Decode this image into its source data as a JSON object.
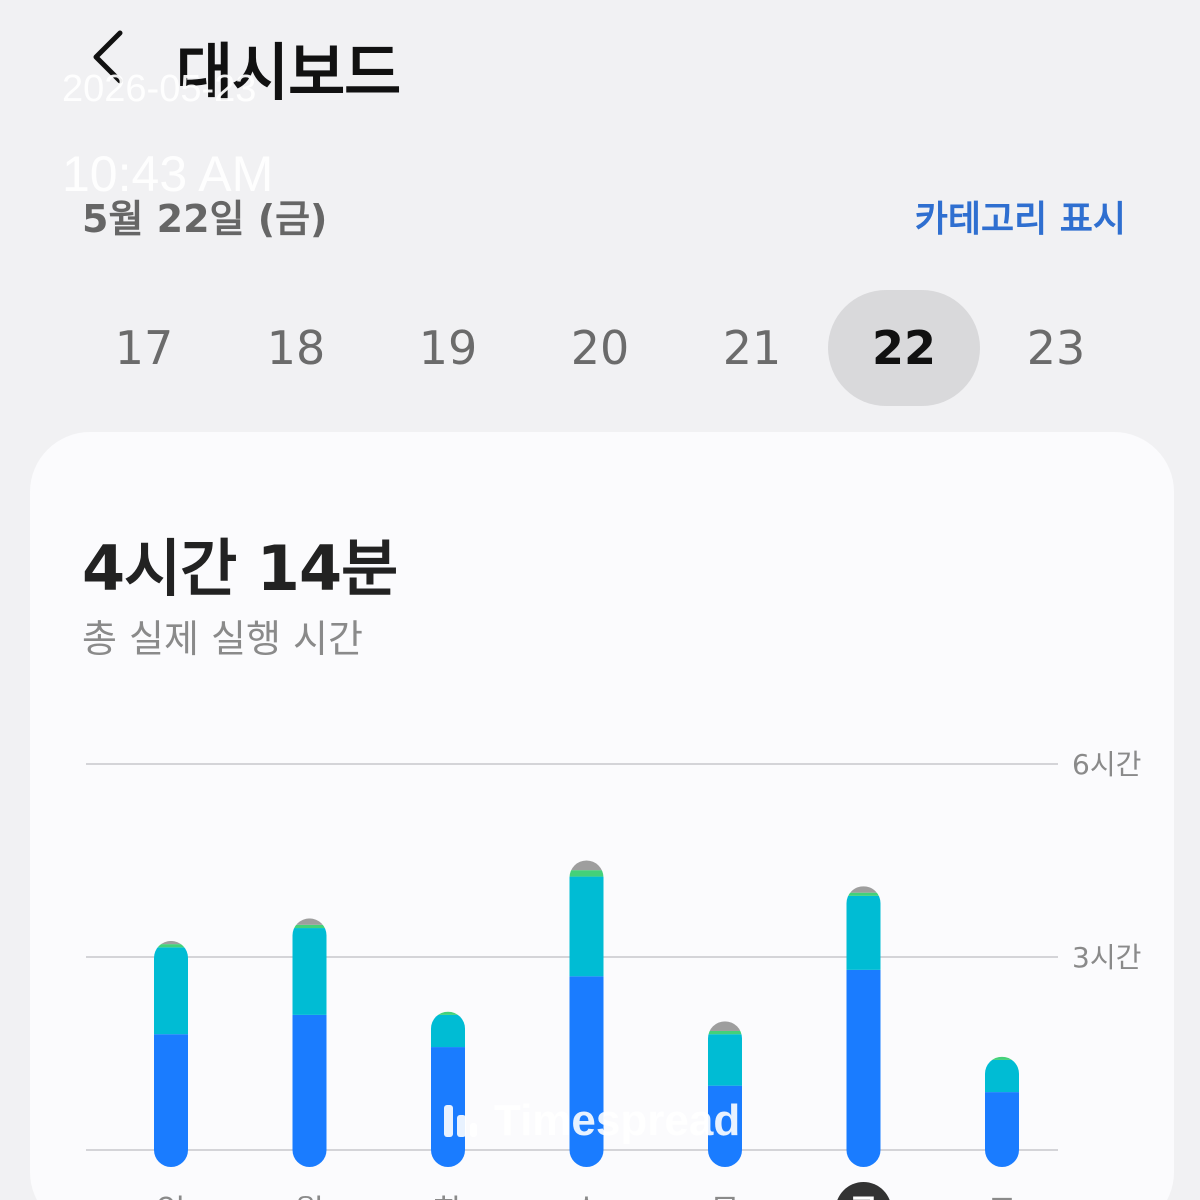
{
  "header": {
    "back_icon": "chevron-left-icon",
    "title": "대시보드"
  },
  "overlay": {
    "date": "2026-05-23",
    "time": "10:43 AM"
  },
  "date_label": "5월 22일 (금)",
  "category_toggle": "카테고리 표시",
  "day_strip": {
    "days": [
      "17",
      "18",
      "19",
      "20",
      "21",
      "22",
      "23"
    ],
    "selected": "22"
  },
  "summary": {
    "total_time": "4시간 14분",
    "label": "총 실제 실행 시간"
  },
  "watermark": "Timespread",
  "colors": {
    "accent": "#2f6fd0",
    "bar_blue": "#1a7cff",
    "bar_teal": "#00bcd4",
    "bar_green": "#43d17a",
    "bar_gray": "#9e9e9e",
    "selected_day_bg": "#d9d9db"
  },
  "chart_data": {
    "type": "bar",
    "stacked": true,
    "categories": [
      "일",
      "월",
      "화",
      "수",
      "목",
      "금",
      "토"
    ],
    "selected_category": "금",
    "series": [
      {
        "color": "#1a7cff",
        "values": [
          1.8,
          2.1,
          1.6,
          2.7,
          1.0,
          2.8,
          0.9
        ]
      },
      {
        "color": "#00bcd4",
        "values": [
          1.35,
          1.35,
          0.5,
          1.55,
          0.8,
          1.15,
          0.5
        ]
      },
      {
        "color": "#43d17a",
        "values": [
          0.05,
          0.05,
          0.05,
          0.1,
          0.05,
          0.05,
          0.05
        ]
      },
      {
        "color": "#9e9e9e",
        "values": [
          0.05,
          0.1,
          0.0,
          0.15,
          0.15,
          0.1,
          0.0
        ]
      }
    ],
    "y_ticks": [
      "6시간",
      "3시간"
    ],
    "ylim": [
      0,
      6
    ],
    "grid": true
  }
}
